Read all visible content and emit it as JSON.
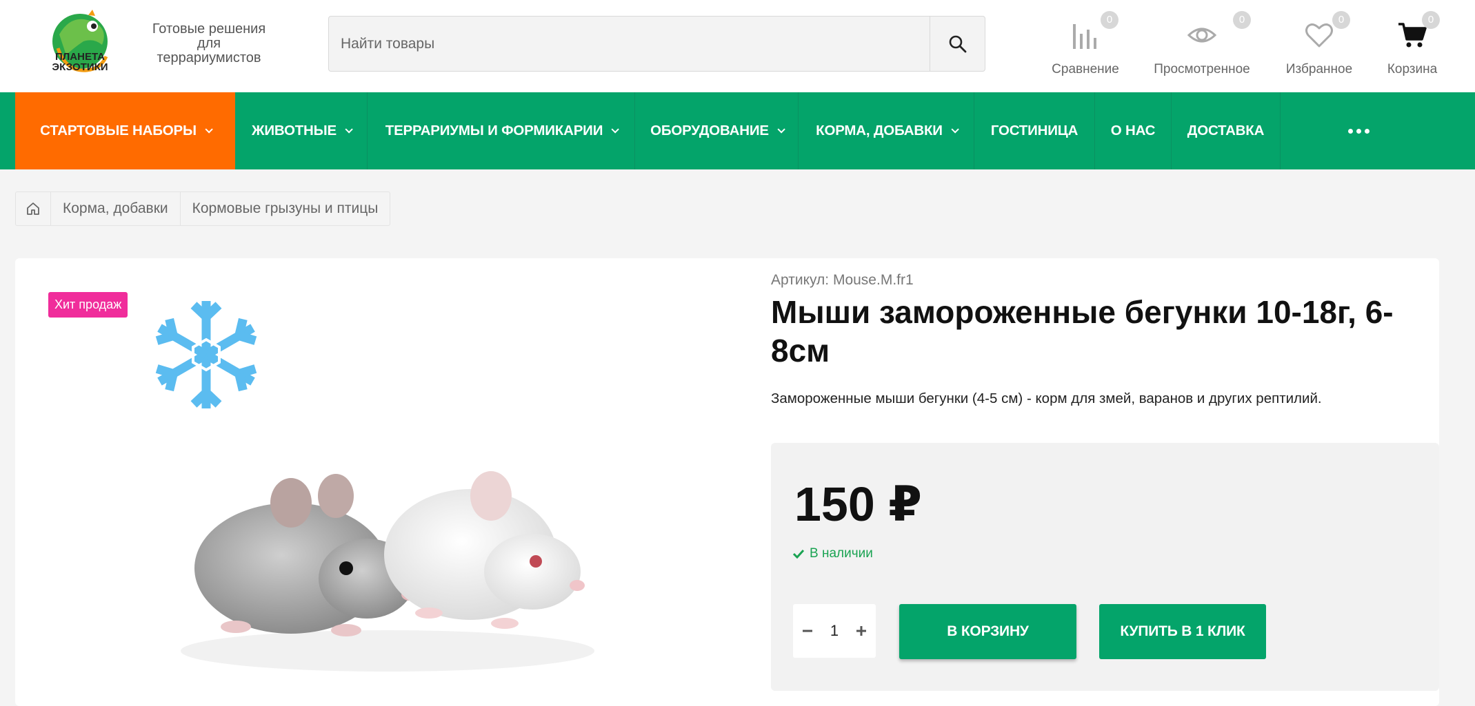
{
  "header": {
    "logo_text": "ПЛАНЕТА ЭКЗОТИКИ",
    "tagline": "Готовые решения для террариумистов",
    "search": {
      "placeholder": "Найти товары"
    },
    "compare": {
      "label": "Сравнение",
      "count": "0"
    },
    "viewed": {
      "label": "Просмотренное",
      "count": "0"
    },
    "favorites": {
      "label": "Избранное",
      "count": "0"
    },
    "cart": {
      "label": "Корзина",
      "count": "0"
    }
  },
  "nav": {
    "items": [
      {
        "label": "СТАРТОВЫЕ НАБОРЫ"
      },
      {
        "label": "ЖИВОТНЫЕ"
      },
      {
        "label": "ТЕРРАРИУМЫ И ФОРМИКАРИИ"
      },
      {
        "label": "ОБОРУДОВАНИЕ"
      },
      {
        "label": "КОРМА, ДОБАВКИ"
      },
      {
        "label": "ГОСТИНИЦА"
      },
      {
        "label": "О НАС"
      },
      {
        "label": "ДОСТАВКА"
      }
    ]
  },
  "breadcrumb": [
    "Корма, добавки",
    "Кормовые грызуны и птицы"
  ],
  "product": {
    "badge": "Хит продаж",
    "article": "Артикул: Mouse.M.fr1",
    "title": "Мыши замороженные бегунки 10-18г, 6-8см",
    "description": "Замороженные мыши бегунки (4-5 см) - корм для змей, варанов и других рептилий.",
    "price": "150 ₽",
    "stock": "В наличии",
    "quantity": "1",
    "add_to_cart": "В КОРЗИНУ",
    "buy_one_click": "КУПИТЬ В 1 КЛИК"
  },
  "colors": {
    "brand_green": "#04a46a",
    "accent_orange": "#ff6b00",
    "badge_pink": "#f02d9b",
    "stock_green": "#1aa352"
  }
}
